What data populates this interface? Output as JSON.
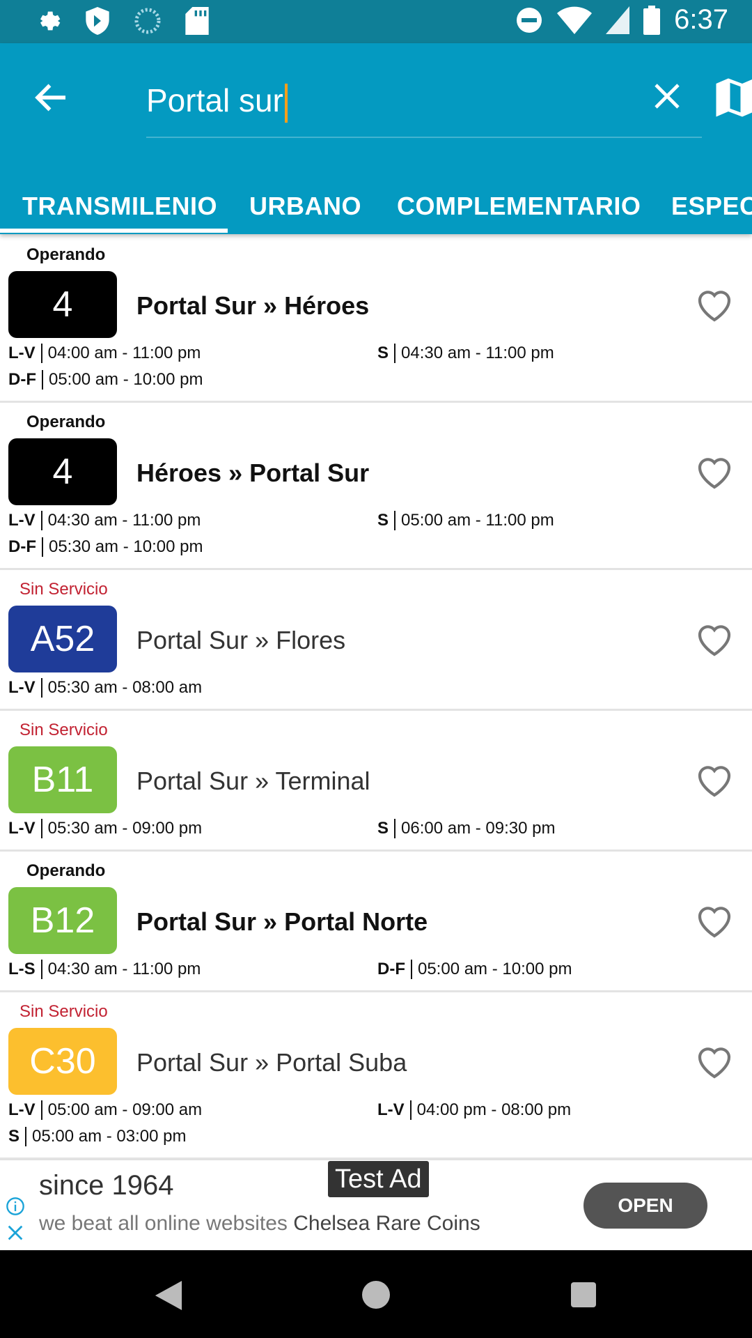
{
  "status_bar": {
    "time": "6:37",
    "left_icons": [
      "gear-icon",
      "shield-icon",
      "loading-icon",
      "sd-card-icon"
    ],
    "right_icons": [
      "dnd-icon",
      "wifi-icon",
      "signal-icon",
      "battery-icon"
    ]
  },
  "search": {
    "query": "Portal sur"
  },
  "tabs": [
    {
      "label": "TRANSMILENIO",
      "active": true
    },
    {
      "label": "URBANO",
      "active": false
    },
    {
      "label": "COMPLEMENTARIO",
      "active": false
    },
    {
      "label": "ESPECI",
      "active": false
    }
  ],
  "colors": {
    "primary": "#049ac1",
    "status_bar": "#0f7f97",
    "operating": "#111111",
    "no_service": "#c22232",
    "badge_black": "#000000",
    "badge_blue": "#1f3c99",
    "badge_green": "#7bc143",
    "badge_yellow": "#fcbf2e"
  },
  "routes": [
    {
      "status": "Operando",
      "operating": true,
      "code": "4",
      "badge_color": "#000000",
      "name": "Portal Sur » Héroes",
      "schedules": [
        {
          "day": "L-V",
          "hours": "04:00 am - 11:00 pm"
        },
        {
          "day": "S",
          "hours": "04:30 am - 11:00 pm"
        },
        {
          "day": "D-F",
          "hours": "05:00 am - 10:00 pm"
        }
      ]
    },
    {
      "status": "Operando",
      "operating": true,
      "code": "4",
      "badge_color": "#000000",
      "name": "Héroes » Portal Sur",
      "schedules": [
        {
          "day": "L-V",
          "hours": "04:30 am - 11:00 pm"
        },
        {
          "day": "S",
          "hours": "05:00 am - 11:00 pm"
        },
        {
          "day": "D-F",
          "hours": "05:30 am - 10:00 pm"
        }
      ]
    },
    {
      "status": "Sin Servicio",
      "operating": false,
      "code": "A52",
      "badge_color": "#1f3c99",
      "name": "Portal Sur » Flores",
      "schedules": [
        {
          "day": "L-V",
          "hours": "05:30 am - 08:00 am"
        }
      ]
    },
    {
      "status": "Sin Servicio",
      "operating": false,
      "code": "B11",
      "badge_color": "#7bc143",
      "name": "Portal Sur » Terminal",
      "schedules": [
        {
          "day": "L-V",
          "hours": "05:30 am - 09:00 pm"
        },
        {
          "day": "S",
          "hours": "06:00 am - 09:30 pm"
        }
      ]
    },
    {
      "status": "Operando",
      "operating": true,
      "code": "B12",
      "badge_color": "#7bc143",
      "name": "Portal Sur » Portal Norte",
      "schedules": [
        {
          "day": "L-S",
          "hours": "04:30 am - 11:00 pm"
        },
        {
          "day": "D-F",
          "hours": "05:00 am - 10:00 pm"
        }
      ]
    },
    {
      "status": "Sin Servicio",
      "operating": false,
      "code": "C30",
      "badge_color": "#fcbf2e",
      "name": "Portal Sur » Portal Suba",
      "schedules": [
        {
          "day": "L-V",
          "hours": "05:00 am - 09:00 am"
        },
        {
          "day": "L-V",
          "hours": "04:00 pm - 08:00 pm"
        },
        {
          "day": "S",
          "hours": "05:00 am - 03:00 pm"
        }
      ]
    }
  ],
  "ad": {
    "title": "since 1964",
    "description": "we beat all online websites",
    "advertiser": "Chelsea Rare Coins",
    "label": "Test Ad",
    "cta": "OPEN"
  }
}
